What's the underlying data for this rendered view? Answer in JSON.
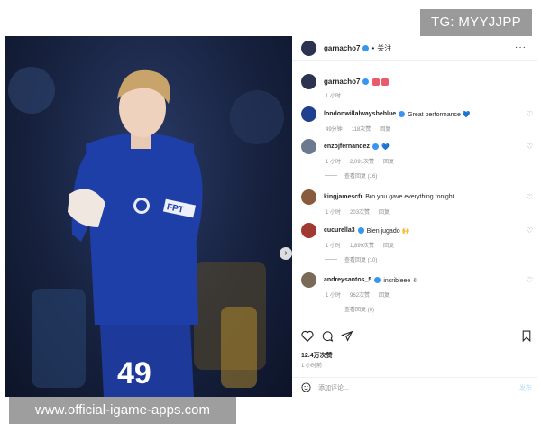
{
  "watermarks": {
    "top": "TG: MYYJJPP",
    "bottom": "www.official-igame-apps.com"
  },
  "photo": {
    "jersey_number": "49",
    "sponsor": "FPT"
  },
  "post": {
    "username": "garnacho7",
    "separator": "•",
    "follow_label": "关注",
    "more_label": "···",
    "caption_time": "1 小时",
    "caption_badges": [
      "badge",
      "badge"
    ]
  },
  "comments": [
    {
      "user": "londonwillalwaysbeblue",
      "text": "Great performance 💙",
      "time": "49分钟",
      "likes": "118次赞",
      "reply": "回复",
      "avatar_color": "#1f3f8f"
    },
    {
      "user": "enzojfernandez",
      "text": "💙",
      "time": "1 小时",
      "likes": "2,091次赞",
      "reply": "回复",
      "view_replies": "查看回复 (16)",
      "avatar_color": "#6b7a8f"
    },
    {
      "user": "kingjamescfr",
      "text": "Bro you gave everything tonight",
      "time": "1 小时",
      "likes": "203次赞",
      "reply": "回复",
      "avatar_color": "#8a5a3c"
    },
    {
      "user": "cucurella3",
      "text": "Bien jugado 🙌",
      "time": "1 小时",
      "likes": "1,899次赞",
      "reply": "回复",
      "view_replies": "查看回复 (10)",
      "avatar_color": "#a03a30"
    },
    {
      "user": "andreysantos_5",
      "text": "incribleee ✌",
      "time": "1 小时",
      "likes": "962次赞",
      "reply": "回复",
      "view_replies": "查看回复 (6)",
      "avatar_color": "#7a6a58"
    }
  ],
  "footer": {
    "likes_count": "12.4万次赞",
    "posted_time": "1 小时前",
    "comment_placeholder": "添加评论...",
    "post_button": "发布"
  },
  "icons": {
    "heart": "heart-icon",
    "comment": "comment-icon",
    "share": "share-icon",
    "save": "bookmark-icon",
    "emoji": "emoji-icon"
  },
  "colors": {
    "verified": "#3797f0",
    "jersey": "#1e3fa8",
    "link_disabled": "#b2dffc"
  }
}
